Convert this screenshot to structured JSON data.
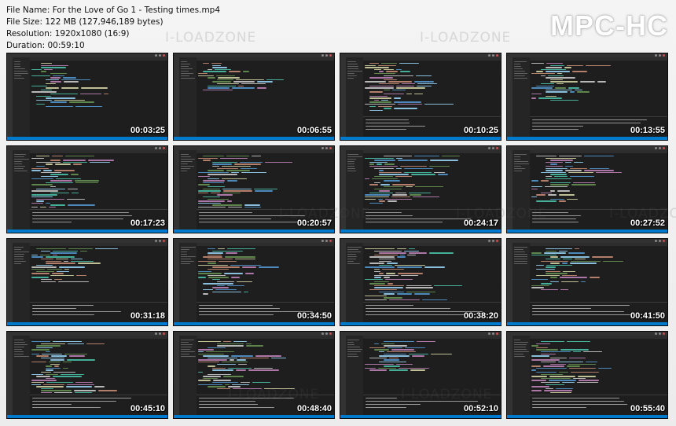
{
  "file_info": {
    "file_name": "File Name: For the Love of Go 1 - Testing times.mp4",
    "file_size": "File Size: 122 MB (127,946,189 bytes)",
    "resolution": "Resolution: 1920x1080 (16:9)",
    "duration": "Duration: 00:59:10"
  },
  "brand": "MPC-HC",
  "watermark": "I-LOADZONE",
  "colors": {
    "editor_bg": "#1e1e1e",
    "status_bar": "#007acc",
    "code_palette": [
      "#9cdcfe",
      "#569cd6",
      "#ce9178",
      "#dcdcaa",
      "#c586c0",
      "#4ec9b0",
      "#d4d4d4",
      "#6a9955"
    ]
  },
  "thumbnails": [
    {
      "timestamp": "00:03:25"
    },
    {
      "timestamp": "00:06:55"
    },
    {
      "timestamp": "00:10:25"
    },
    {
      "timestamp": "00:13:55"
    },
    {
      "timestamp": "00:17:23"
    },
    {
      "timestamp": "00:20:57"
    },
    {
      "timestamp": "00:24:17"
    },
    {
      "timestamp": "00:27:52"
    },
    {
      "timestamp": "00:31:18"
    },
    {
      "timestamp": "00:34:50"
    },
    {
      "timestamp": "00:38:20"
    },
    {
      "timestamp": "00:41:50"
    },
    {
      "timestamp": "00:45:10"
    },
    {
      "timestamp": "00:48:40"
    },
    {
      "timestamp": "00:52:10"
    },
    {
      "timestamp": "00:55:40"
    }
  ]
}
